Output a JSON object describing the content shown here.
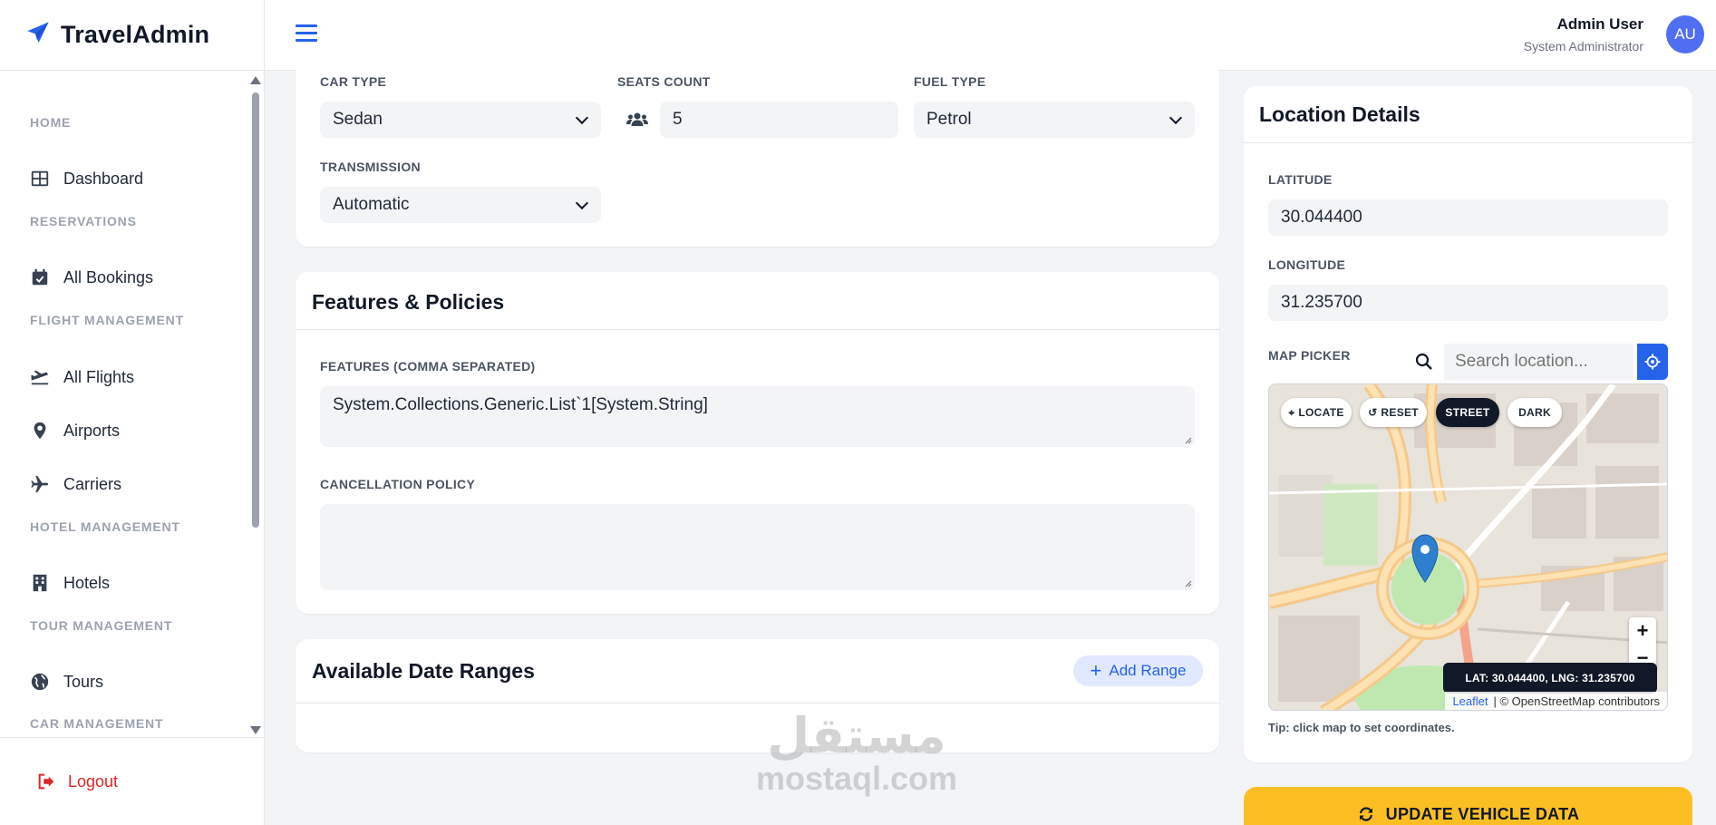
{
  "brand": {
    "name": "TravelAdmin"
  },
  "header": {
    "user_name": "Admin User",
    "user_role": "System Administrator",
    "avatar_initials": "AU"
  },
  "sidebar": {
    "sections": [
      {
        "title": "HOME",
        "items": [
          {
            "label": "Dashboard",
            "icon": "dashboard-icon"
          }
        ]
      },
      {
        "title": "RESERVATIONS",
        "items": [
          {
            "label": "All Bookings",
            "icon": "calendar-check-icon"
          }
        ]
      },
      {
        "title": "FLIGHT MANAGEMENT",
        "items": [
          {
            "label": "All Flights",
            "icon": "plane-departure-icon"
          },
          {
            "label": "Airports",
            "icon": "map-pin-icon"
          },
          {
            "label": "Carriers",
            "icon": "plane-icon"
          }
        ]
      },
      {
        "title": "HOTEL MANAGEMENT",
        "items": [
          {
            "label": "Hotels",
            "icon": "building-icon"
          }
        ]
      },
      {
        "title": "TOUR MANAGEMENT",
        "items": [
          {
            "label": "Tours",
            "icon": "globe-icon"
          }
        ]
      },
      {
        "title": "CAR MANAGEMENT",
        "items": []
      }
    ],
    "logout_label": "Logout"
  },
  "vehicle": {
    "car_type_label": "CAR TYPE",
    "car_type_value": "Sedan",
    "seats_label": "SEATS COUNT",
    "seats_value": "5",
    "fuel_label": "FUEL TYPE",
    "fuel_value": "Petrol",
    "transmission_label": "TRANSMISSION",
    "transmission_value": "Automatic"
  },
  "features": {
    "title": "Features & Policies",
    "features_label": "FEATURES (COMMA SEPARATED)",
    "features_value": "System.Collections.Generic.List`1[System.String]",
    "cancellation_label": "CANCELLATION POLICY",
    "cancellation_value": ""
  },
  "date_ranges": {
    "title": "Available Date Ranges",
    "add_label": "Add Range"
  },
  "location": {
    "title": "Location Details",
    "latitude_label": "LATITUDE",
    "latitude_value": "30.044400",
    "longitude_label": "LONGITUDE",
    "longitude_value": "31.235700",
    "map_picker_label": "MAP PICKER",
    "search_placeholder": "Search location...",
    "map_buttons": {
      "locate": "LOCATE",
      "reset": "RESET",
      "street": "STREET",
      "dark": "DARK"
    },
    "coord_readout": "LAT: 30.044400, LNG: 31.235700",
    "attribution_leaflet": "Leaflet",
    "attribution_osm": "| © OpenStreetMap contributors",
    "tip": "Tip: click map to set coordinates."
  },
  "update_button_label": "UPDATE VEHICLE DATA",
  "watermark": {
    "arabic": "مستقل",
    "latin": "mostaql.com"
  },
  "colors": {
    "primary": "#2563eb",
    "accent_yellow": "#fbbf24",
    "danger": "#dc2626"
  }
}
